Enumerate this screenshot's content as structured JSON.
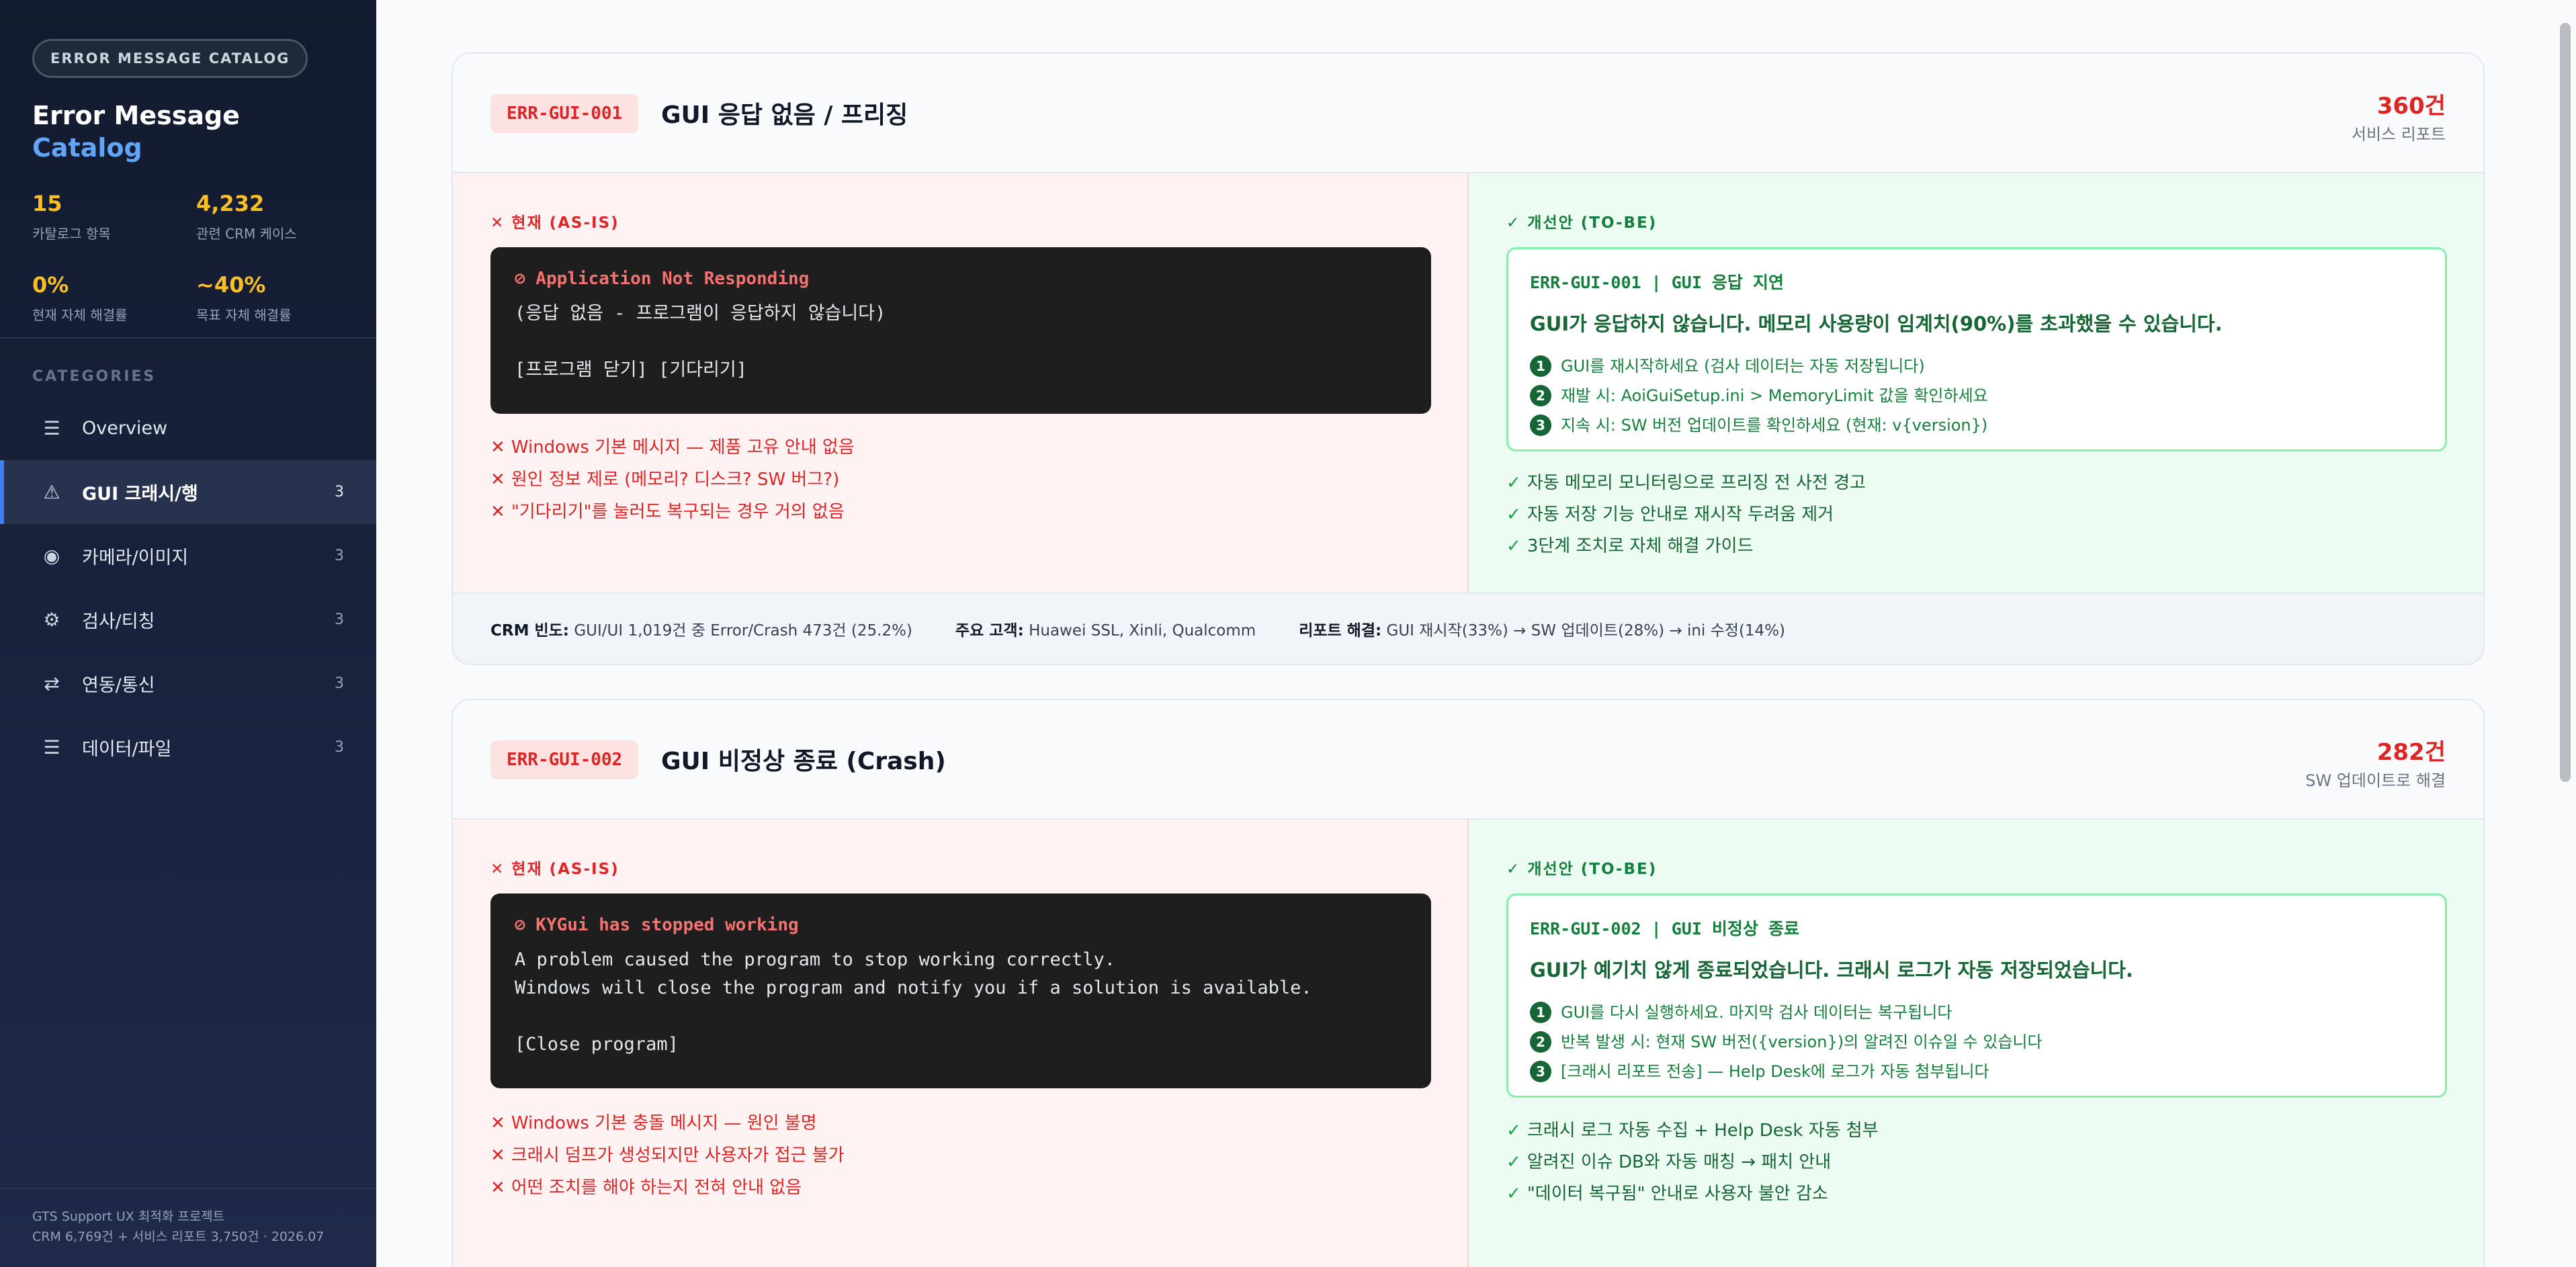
{
  "sidebar": {
    "badge": "ERROR MESSAGE CATALOG",
    "title_line1": "Error Message",
    "title_line2": "Catalog",
    "stats": [
      {
        "value": "15",
        "label": "카탈로그 항목"
      },
      {
        "value": "4,232",
        "label": "관련 CRM 케이스"
      },
      {
        "value": "0%",
        "label": "현재 자체 해결률"
      },
      {
        "value": "~40%",
        "label": "목표 자체 해결률"
      }
    ],
    "categories_heading": "CATEGORIES",
    "items": [
      {
        "icon": "list-icon",
        "glyph": "☰",
        "label": "Overview",
        "count": ""
      },
      {
        "icon": "warning-icon",
        "glyph": "⚠",
        "label": "GUI 크래시/행",
        "count": "3"
      },
      {
        "icon": "camera-icon",
        "glyph": "◉",
        "label": "카메라/이미지",
        "count": "3"
      },
      {
        "icon": "gear-icon",
        "glyph": "⚙",
        "label": "검사/티칭",
        "count": "3"
      },
      {
        "icon": "swap-icon",
        "glyph": "⇄",
        "label": "연동/통신",
        "count": "3"
      },
      {
        "icon": "list-icon",
        "glyph": "☰",
        "label": "데이터/파일",
        "count": "3"
      }
    ],
    "footer_line1": "GTS Support UX 최적화 프로젝트",
    "footer_line2": "CRM 6,769건 + 서비스 리포트 3,750건 · 2026.07"
  },
  "cards": [
    {
      "code": "ERR-GUI-001",
      "title": "GUI 응답 없음 / 프리징",
      "count": "360건",
      "count_note": "서비스 리포트",
      "asis_label": "✕ 현재 (AS-IS)",
      "terminal_title": "⊘ Application Not Responding",
      "terminal_body": "(응답 없음 - 프로그램이 응답하지 않습니다)\n\n[프로그램 닫기]  [기다리기]",
      "issues": [
        "Windows 기본 메시지 — 제품 고유 안내 없음",
        "원인 정보 제로 (메모리? 디스크? SW 버그?)",
        "\"기다리기\"를 눌러도 복구되는 경우 거의 없음"
      ],
      "tobe_label": "✓ 개선안 (TO-BE)",
      "fix_code": "ERR-GUI-001 | GUI 응답 지연",
      "fix_message": "GUI가 응답하지 않습니다. 메모리 사용량이 임계치(90%)를 초과했을 수 있습니다.",
      "steps": [
        "GUI를 재시작하세요 (검사 데이터는 자동 저장됩니다)",
        "재발 시: AoiGuiSetup.ini > MemoryLimit 값을 확인하세요",
        "지속 시: SW 버전 업데이트를 확인하세요 (현재: v{version})"
      ],
      "benefits": [
        "자동 메모리 모니터링으로 프리징 전 사전 경고",
        "자동 저장 기능 안내로 재시작 두려움 제거",
        "3단계 조치로 자체 해결 가이드"
      ],
      "footer": [
        {
          "key": "CRM 빈도:",
          "value": "GUI/UI 1,019건 중 Error/Crash 473건 (25.2%)"
        },
        {
          "key": "주요 고객:",
          "value": "Huawei SSL, Xinli, Qualcomm"
        },
        {
          "key": "리포트 해결:",
          "value": "GUI 재시작(33%) → SW 업데이트(28%) → ini 수정(14%)"
        }
      ]
    },
    {
      "code": "ERR-GUI-002",
      "title": "GUI 비정상 종료 (Crash)",
      "count": "282건",
      "count_note": "SW 업데이트로 해결",
      "asis_label": "✕ 현재 (AS-IS)",
      "terminal_title": "⊘ KYGui has stopped working",
      "terminal_body": "A problem caused the program to stop working correctly.\nWindows will close the program and notify you if a solution is available.\n\n[Close program]",
      "issues": [
        "Windows 기본 충돌 메시지 — 원인 불명",
        "크래시 덤프가 생성되지만 사용자가 접근 불가",
        "어떤 조치를 해야 하는지 전혀 안내 없음"
      ],
      "tobe_label": "✓ 개선안 (TO-BE)",
      "fix_code": "ERR-GUI-002 | GUI 비정상 종료",
      "fix_message": "GUI가 예기치 않게 종료되었습니다. 크래시 로그가 자동 저장되었습니다.",
      "steps": [
        "GUI를 다시 실행하세요. 마지막 검사 데이터는 복구됩니다",
        "반복 발생 시: 현재 SW 버전({version})의 알려진 이슈일 수 있습니다",
        "[크래시 리포트 전송] — Help Desk에 로그가 자동 첨부됩니다"
      ],
      "benefits": [
        "크래시 로그 자동 수집 + Help Desk 자동 첨부",
        "알려진 이슈 DB와 자동 매칭 → 패치 안내",
        "\"데이터 복구됨\" 안내로 사용자 불안 감소"
      ],
      "footer": []
    }
  ],
  "colors": {
    "sidebar_bg": "#121a2e",
    "accent_blue": "#3b82f6",
    "stat_yellow": "#fbbf24",
    "error_red": "#dc2626",
    "success_green": "#15803d"
  }
}
